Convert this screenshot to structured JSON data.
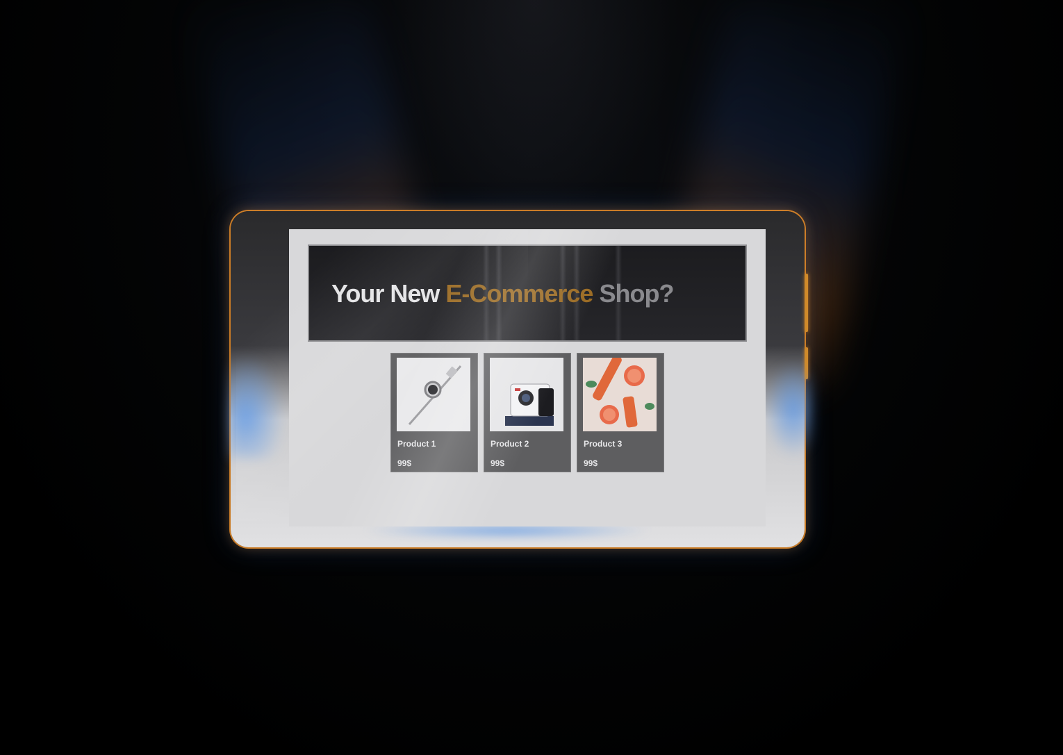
{
  "hero": {
    "title_part1": "Your New ",
    "title_part2": "E-Commerce",
    "title_part3": " Shop?"
  },
  "products": [
    {
      "name": "Product 1",
      "price": "99$",
      "image_icon": "smartwatch-image"
    },
    {
      "name": "Product 2",
      "price": "99$",
      "image_icon": "instant-camera-image"
    },
    {
      "name": "Product 3",
      "price": "99$",
      "image_icon": "grapefruit-cosmetics-image"
    }
  ],
  "colors": {
    "accent": "#9a6a22",
    "device_rim": "#d08a2a",
    "glow_blue": "#5a96e6",
    "card_bg": "#5e5e60",
    "screen_bg": "#d8d8da"
  }
}
